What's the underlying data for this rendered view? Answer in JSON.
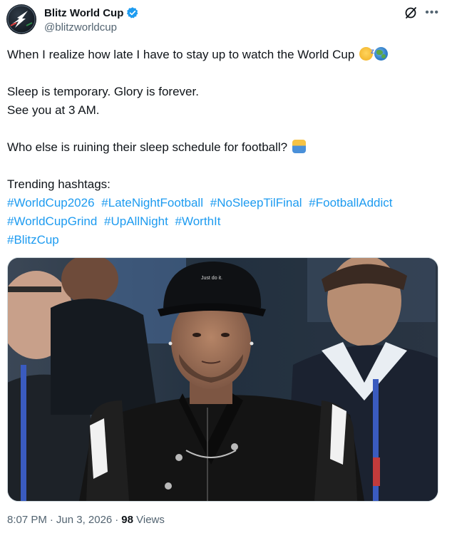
{
  "author": {
    "display_name": "Blitz World Cup",
    "handle": "@blitzworldcup"
  },
  "icons": {
    "verified": "verified-badge-icon",
    "grok": "grok-icon",
    "more": "more-options-icon"
  },
  "tweet": {
    "line1": "When I realize how late I have to stay up to watch the World Cup",
    "line2": "Sleep is temporary. Glory is forever.",
    "line3": "See you at 3 AM.",
    "line4": "Who else is ruining their sleep schedule for football?",
    "trending_label": "Trending hashtags:",
    "hashtags": [
      "#WorldCup2026",
      "#LateNightFootball",
      "#NoSleepTilFinal",
      "#FootballAddict",
      "#WorldCupGrind",
      "#UpAllNight",
      "#WorthIt",
      "#BlitzCup"
    ]
  },
  "media": {
    "cap_text": "Just do it."
  },
  "meta": {
    "time": "8:07 PM",
    "separator": "·",
    "date": "Jun 3, 2026",
    "views_count": "98",
    "views_label": "Views"
  },
  "colors": {
    "link": "#1d9bf0",
    "text": "#0f1419",
    "secondary": "#536471",
    "verified": "#1d9bf0"
  }
}
